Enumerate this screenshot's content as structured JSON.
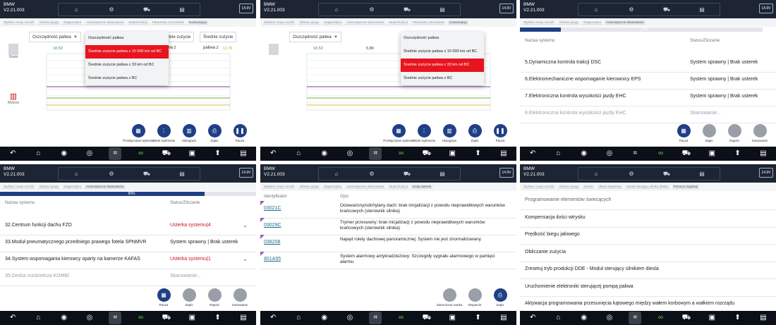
{
  "common": {
    "brand": "BMW",
    "version": "V2.21.003",
    "battery": "14.9V",
    "topicons": [
      "home-icon",
      "gear-icon",
      "car-icon",
      "print-icon"
    ],
    "nav": [
      "back-icon",
      "home-icon",
      "camera-icon",
      "globe-icon",
      "crop-icon",
      "link-icon",
      "car-icon",
      "vci-icon",
      "upload-icon",
      "book-icon"
    ]
  },
  "p1": {
    "crumbs": [
      "Wybierz nowy rocznik",
      "Główne grupy",
      "Diagnostyka",
      "Automatyczne skanowanie",
      "Moduł funkcji",
      "Parametry rzeczywiste",
      "Konsumpcja"
    ],
    "dd1": "Oszczędność paliwa",
    "menu": [
      "Oszczędność paliwa",
      "Średnie zużycie paliwa z 10 000 km od BC",
      "Średnie zużycie paliwa z 33 km od BC",
      "Średnie zużycie paliwa z BC"
    ],
    "menu_sel": 1,
    "dd2": "Średnie zużycie paliwa z",
    "dd3": "Średnie zużycie paliwa z",
    "v1": "18.50",
    "v2": "5.89",
    "v3": "11.76",
    "side1": "Hasło",
    "side2": "Wykres",
    "actions": [
      "Przełączanie wykresu",
      "Wiele wykresów",
      "Histogram",
      "Zapis",
      "Pauza"
    ]
  },
  "p2": {
    "crumbs": [
      "Wybierz nowy rocznik",
      "Główne grupy",
      "Diagnostyka",
      "Automatyczne skanowanie",
      "Moduł funkcji",
      "Parametry rzeczywiste",
      "Konsumpcja"
    ],
    "dd1": "Oszczędność paliwa",
    "menu": [
      "Oszczędność paliwa",
      "Średnie zużycie paliwa z 10 000 km od BC",
      "Średnie zużycie paliwa z 33 km od BC",
      "Średnie zużycie paliwa z BC"
    ],
    "menu_sel": 2,
    "v1": "18.50",
    "v2": "5.89",
    "actions": [
      "Przełączanie wykresu",
      "Wiele wykresów",
      "Histogram",
      "Zapis",
      "Pauza"
    ]
  },
  "p3": {
    "crumbs": [
      "Wybierz nowy rocznik",
      "Główne grupy",
      "Diagnostyka",
      "Automatyczne skanowanie"
    ],
    "progress": 0.17,
    "progress_label": "17%",
    "col1": "Nazwa systemu",
    "col2": "Status/Zliczanie",
    "rows": [
      {
        "name": "5.Dynamiczna kontrola trakcji DSC",
        "status": "System sprawny | Brak usterek"
      },
      {
        "name": "6.Elektromechaniczne wspomaganie kierownicy EPS",
        "status": "System sprawny | Brak usterek"
      },
      {
        "name": "7.Elektroniczna kontrola wysokości jazdy EHC",
        "status": "System sprawny | Brak usterek"
      },
      {
        "name": "8.Elektroniczna kontrola wysokości jazdy EHC",
        "status": "Skanowanie..."
      }
    ],
    "actions": [
      "Pauza",
      "Zapis",
      "Raport",
      "Kasowanie"
    ]
  },
  "p4": {
    "crumbs": [
      "Wybierz nowy rocznik",
      "Główne grupy",
      "Diagnostyka",
      "Automatyczne skanowanie"
    ],
    "progress": 0.8,
    "progress_label": "80%",
    "col1": "Nazwa systemu",
    "col2": "Status/Zliczanie",
    "rows": [
      {
        "name": "32.Centrum funkcji dachu FZD",
        "status": "Usterka systemu|4"
      },
      {
        "name": "33.Moduł pneumatycznego przedniego prawego fotela SPNMVR",
        "status": "System sprawny | Brak usterek"
      },
      {
        "name": "34.System wspomagania kierowcy oparty na kamerze KAFAS",
        "status": "Usterka systemu|1"
      },
      {
        "name": "35.Deska rozdzielcza KOMBI",
        "status": "Skanowanie..."
      }
    ],
    "actions": [
      "Pauza",
      "Zapis",
      "Raport",
      "Kasowanie"
    ]
  },
  "p5": {
    "crumbs": [
      "Wybierz nowy rocznik",
      "Główne grupy",
      "Diagnostyka",
      "Automatyczne skanowanie",
      "Moduł funkcji",
      "Kody usterek"
    ],
    "col1": "Identyfikator",
    "col2": "Opis",
    "rows": [
      {
        "code": "03021C",
        "desc": "Ocieważony/odchylany dach: brak inicjalizacji z powodu nieprawidłowych warunków krańcowych (sterownik silnika)"
      },
      {
        "code": "03029C",
        "desc": "Trymer przesuwny: brak inicjalizacji z powodu nieprawidłowych warunków krańcowych (sterownik silnika)"
      },
      {
        "code": "038208",
        "desc": "Napęd rolety dachowej panoramicznej: System nie jest znormalizowany"
      },
      {
        "code": "801A55",
        "desc": "System alarmowy antykradzieżowy: Szczegóły sygnału alarmowego w pamięci alarmu"
      }
    ],
    "actions": [
      "Zamrożona ramka",
      "Wsparcie",
      "Zapis"
    ]
  },
  "p6": {
    "crumbs": [
      "Wybierz nowy rocznik",
      "Główne grupy",
      "Serwis",
      "Układ napędowy",
      "Moduł sterujący silnika (DME)",
      "Pomoce regulacji"
    ],
    "items": [
      "Programowanie elementów świecących",
      "Kompensacja ilości wtrysku",
      "Prędkość biegu jałowego",
      "Obliczanie zużycia",
      "Zresetuj tryb produkcji DDE - Moduł sterujący silnikiem diesla",
      "Uruchomienie elektroniki sterującej pompą paliwa",
      "Aktywacja programowania przesunięcia kątowego między wałem korbowym a wałkiem rozrządu"
    ]
  }
}
